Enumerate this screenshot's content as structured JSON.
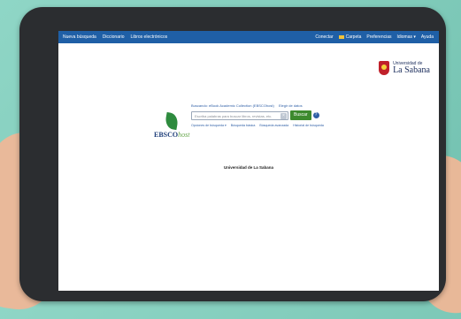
{
  "topbar": {
    "left_items": [
      "Nueva búsqueda",
      "Diccionario",
      "Libros electrónicos"
    ],
    "right_items": [
      "Conectar",
      "Carpeta",
      "Preferencias",
      "Idiomas ▾",
      "Ayuda"
    ]
  },
  "branding": {
    "university_small": "Universidad de",
    "university_big": "La Sabana",
    "ebsco_name": "EBSCO",
    "ebsco_host": "host"
  },
  "search": {
    "searching_text": "Buscando: eBook Academic Collection (EBSCOhost)",
    "choose_db_link": "Elegir de datos",
    "placeholder": "Escriba palabras para buscar libros, revistas, etc.",
    "button_label": "Buscar",
    "help_label": "?",
    "links": [
      "Opciones de búsqueda ▾",
      "Búsqueda básica",
      "Búsqueda avanzada",
      "Historial de búsqueda"
    ]
  },
  "institution_label": "Universidad de La Sabana",
  "colors": {
    "topbar": "#1f5fa6",
    "search_button": "#3d8a2e",
    "background": "#7fcab9"
  }
}
